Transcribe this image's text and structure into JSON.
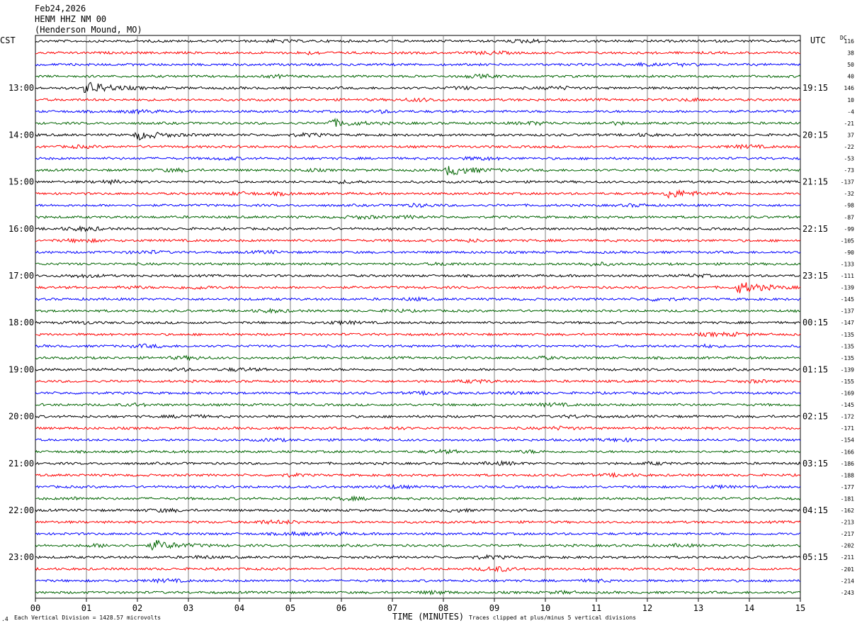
{
  "header": {
    "date": "Feb24,2026",
    "station": "HENM HHZ NM 00",
    "location": "(Henderson Mound, MO)"
  },
  "left_tz": "CST",
  "right_tz": "UTC",
  "dc_header": "DC",
  "footer": {
    "scale_note": "Each Vertical Division = 1428.57 microvolts",
    "axis_title": "TIME (MINUTES)",
    "clip_note": "Traces clipped at plus/minus 5 vertical divisions"
  },
  "colors": {
    "trace_cycle": [
      "#000000",
      "#ff0000",
      "#0000ff",
      "#006400"
    ],
    "grid": "#808080"
  },
  "chart_data": {
    "type": "helicorder",
    "x_axis": {
      "label": "TIME (MINUTES)",
      "range": [
        0,
        15
      ],
      "ticks": [
        "00",
        "01",
        "02",
        "03",
        "04",
        "05",
        "06",
        "07",
        "08",
        "09",
        "10",
        "11",
        "12",
        "13",
        "14",
        "15"
      ]
    },
    "minutes_per_line": 15,
    "left_hour_labels": [
      "13:00",
      "14:00",
      "15:00",
      "16:00",
      "17:00",
      "18:00",
      "19:00",
      "20:00",
      "21:00",
      "22:00",
      "23:00"
    ],
    "right_hour_labels": [
      "19:15",
      "20:15",
      "21:15",
      "22:15",
      "23:15",
      "00:15",
      "01:15",
      "02:15",
      "03:15",
      "04:15",
      "05:15"
    ],
    "label_every_n_lines": 4,
    "first_labeled_line": 4,
    "dc_offsets": [
      "116",
      "38",
      "50",
      "40",
      "146",
      "10",
      "-4",
      "-21",
      "37",
      "-22",
      "-53",
      "-73",
      "-137",
      "-32",
      "-98",
      "-87",
      "-99",
      "-105",
      "-90",
      "-133",
      "-111",
      "-139",
      "-145",
      "-137",
      "-147",
      "-135",
      "-135",
      "-135",
      "-139",
      "-155",
      "-169",
      "-145",
      "-172",
      "-171",
      "-154",
      "-166",
      "-186",
      "-188",
      "-177",
      "-181",
      "-162",
      "-213",
      "-217",
      "-202",
      "-211",
      "-201",
      "-214",
      "-243"
    ],
    "events": [
      {
        "line": 4,
        "minute": 1.0,
        "amp": 9
      },
      {
        "line": 7,
        "minute": 5.8,
        "amp": 5
      },
      {
        "line": 8,
        "minute": 2.0,
        "amp": 6
      },
      {
        "line": 11,
        "minute": 8.1,
        "amp": 7
      },
      {
        "line": 13,
        "minute": 12.4,
        "amp": 6
      },
      {
        "line": 21,
        "minute": 13.8,
        "amp": 8
      },
      {
        "line": 43,
        "minute": 2.3,
        "amp": 7
      }
    ]
  }
}
